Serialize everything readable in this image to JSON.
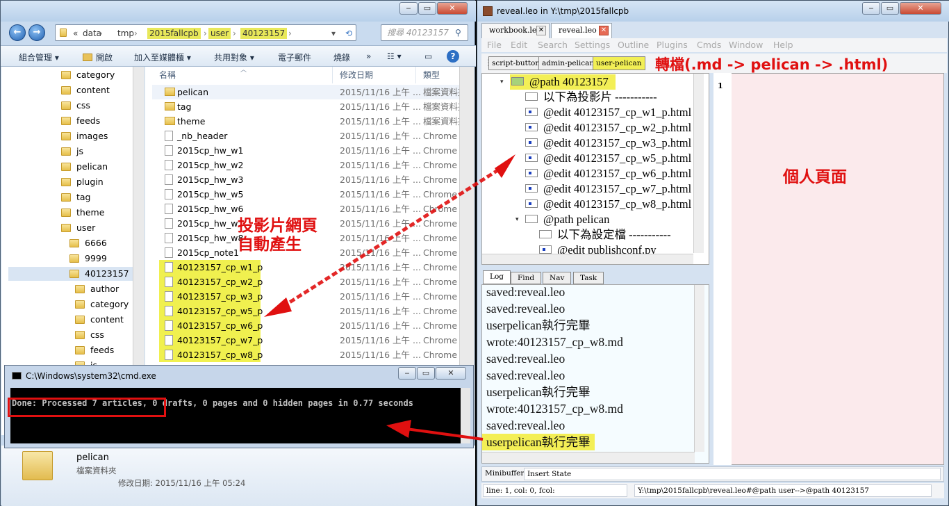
{
  "explorer": {
    "breadcrumbs": [
      "data",
      "tmp",
      "2015fallcpb",
      "user",
      "40123157"
    ],
    "breadcrumb_prefix": "«",
    "search_placeholder": "搜尋 40123157",
    "toolbar": [
      "組合管理 ▾",
      "開啟",
      "加入至媒體櫃 ▾",
      "共用對象 ▾",
      "電子郵件",
      "燒錄",
      "»"
    ],
    "nav_tree": [
      {
        "label": "category",
        "indent": 1
      },
      {
        "label": "content",
        "indent": 1
      },
      {
        "label": "css",
        "indent": 1
      },
      {
        "label": "feeds",
        "indent": 1
      },
      {
        "label": "images",
        "indent": 1
      },
      {
        "label": "js",
        "indent": 1
      },
      {
        "label": "pelican",
        "indent": 1
      },
      {
        "label": "plugin",
        "indent": 1
      },
      {
        "label": "tag",
        "indent": 1
      },
      {
        "label": "theme",
        "indent": 1
      },
      {
        "label": "user",
        "indent": 1
      },
      {
        "label": "6666",
        "indent": 2
      },
      {
        "label": "9999",
        "indent": 2
      },
      {
        "label": "40123157",
        "indent": 2,
        "selected": true
      },
      {
        "label": "author",
        "indent": 3
      },
      {
        "label": "category",
        "indent": 3
      },
      {
        "label": "content",
        "indent": 3
      },
      {
        "label": "css",
        "indent": 3
      },
      {
        "label": "feeds",
        "indent": 3
      },
      {
        "label": "js",
        "indent": 3
      }
    ],
    "columns": [
      "名稱",
      "修改日期",
      "類型"
    ],
    "files": [
      {
        "name": "pelican",
        "date": "2015/11/16 上午 ...",
        "type": "檔案資料夾",
        "folder": true
      },
      {
        "name": "tag",
        "date": "2015/11/16 上午 ...",
        "type": "檔案資料夾",
        "folder": true
      },
      {
        "name": "theme",
        "date": "2015/11/16 上午 ...",
        "type": "檔案資料夾",
        "folder": true
      },
      {
        "name": "_nb_header",
        "date": "2015/11/16 上午 ...",
        "type": "Chrome H"
      },
      {
        "name": "2015cp_hw_w1",
        "date": "2015/11/16 上午 ...",
        "type": "Chrome H"
      },
      {
        "name": "2015cp_hw_w2",
        "date": "2015/11/16 上午 ...",
        "type": "Chrome H"
      },
      {
        "name": "2015cp_hw_w3",
        "date": "2015/11/16 上午 ...",
        "type": "Chrome H"
      },
      {
        "name": "2015cp_hw_w5",
        "date": "2015/11/16 上午 ...",
        "type": "Chrome H"
      },
      {
        "name": "2015cp_hw_w6",
        "date": "2015/11/16 上午 ...",
        "type": "Chrome H"
      },
      {
        "name": "2015cp_hw_w7",
        "date": "2015/11/16 上午 ...",
        "type": "Chrome H"
      },
      {
        "name": "2015cp_hw_w8",
        "date": "2015/11/16 上午 ...",
        "type": "Chrome H"
      },
      {
        "name": "2015cp_note1",
        "date": "2015/11/16 上午 ...",
        "type": "Chrome H"
      },
      {
        "name": "40123157_cp_w1_p",
        "date": "2015/11/16 上午 ...",
        "type": "Chrome H",
        "highlight": true
      },
      {
        "name": "40123157_cp_w2_p",
        "date": "2015/11/16 上午 ...",
        "type": "Chrome H",
        "highlight": true
      },
      {
        "name": "40123157_cp_w3_p",
        "date": "2015/11/16 上午 ...",
        "type": "Chrome H",
        "highlight": true
      },
      {
        "name": "40123157_cp_w5_p",
        "date": "2015/11/16 上午 ...",
        "type": "Chrome H",
        "highlight": true
      },
      {
        "name": "40123157_cp_w6_p",
        "date": "2015/11/16 上午 ...",
        "type": "Chrome H",
        "highlight": true
      },
      {
        "name": "40123157_cp_w7_p",
        "date": "2015/11/16 上午 ...",
        "type": "Chrome H",
        "highlight": true
      },
      {
        "name": "40123157_cp_w8_p",
        "date": "2015/11/16 上午 ...",
        "type": "Chrome H",
        "highlight": true
      }
    ],
    "details": {
      "name": "pelican",
      "type": "檔案資料夾",
      "modified": "修改日期: 2015/11/16 上午 05:24"
    }
  },
  "cmd": {
    "title": "C:\\Windows\\system32\\cmd.exe",
    "output": "Done: Processed 7 articles, 0 drafts, 0 pages and 0 hidden pages in 0.77 seconds"
  },
  "leo": {
    "title": "reveal.leo in Y:\\tmp\\2015fallcpb",
    "tabs": [
      "workbook.leo",
      "reveal.leo"
    ],
    "menu": [
      "File",
      "Edit",
      "Search",
      "Settings",
      "Outline",
      "Plugins",
      "Cmds",
      "Window",
      "Help"
    ],
    "buttons": [
      "script-button",
      "admin-pelican",
      "user-pelican"
    ],
    "outline": [
      {
        "text": "@path 40123157",
        "indent": 0,
        "expand": "▾",
        "selected": true,
        "icon": "green"
      },
      {
        "text": "以下為投影片 -----------",
        "indent": 1,
        "icon": "plain"
      },
      {
        "text": "@edit 40123157_cp_w1_p.html",
        "indent": 1,
        "icon": "dot"
      },
      {
        "text": "@edit 40123157_cp_w2_p.html",
        "indent": 1,
        "icon": "dot"
      },
      {
        "text": "@edit 40123157_cp_w3_p.html",
        "indent": 1,
        "icon": "dot"
      },
      {
        "text": "@edit 40123157_cp_w5_p.html",
        "indent": 1,
        "icon": "dot"
      },
      {
        "text": "@edit 40123157_cp_w6_p.html",
        "indent": 1,
        "icon": "dot"
      },
      {
        "text": "@edit 40123157_cp_w7_p.html",
        "indent": 1,
        "icon": "dot"
      },
      {
        "text": "@edit 40123157_cp_w8_p.html",
        "indent": 1,
        "icon": "dot"
      },
      {
        "text": "@path pelican",
        "indent": 1,
        "expand": "▾",
        "icon": "plain"
      },
      {
        "text": "以下為設定檔 -----------",
        "indent": 2,
        "icon": "plain"
      },
      {
        "text": "@edit publishconf.py",
        "indent": 2,
        "icon": "dot"
      }
    ],
    "body_line_number": "1",
    "log_tabs": [
      "Log",
      "Find",
      "Nav",
      "Task"
    ],
    "log": [
      {
        "text": "saved:reveal.leo"
      },
      {
        "text": "saved:reveal.leo"
      },
      {
        "text": "userpelican執行完畢"
      },
      {
        "text": "wrote:40123157_cp_w8.md"
      },
      {
        "text": "saved:reveal.leo"
      },
      {
        "text": "saved:reveal.leo"
      },
      {
        "text": "userpelican執行完畢"
      },
      {
        "text": "wrote:40123157_cp_w8.md"
      },
      {
        "text": "saved:reveal.leo"
      },
      {
        "text": "userpelican執行完畢",
        "highlight": true
      }
    ],
    "minibuffer_label": "Minibuffer:",
    "minibuffer_value": "Insert State",
    "status_pos": "line: 1, col: 0, fcol:",
    "status_path": "Y:\\tmp\\2015fallcpb\\reveal.leo#@path user-->@path 40123157"
  },
  "annotations": {
    "convert": "轉檔(.md -> pelican -> .html)",
    "auto_generate_line1": "投影片網頁",
    "auto_generate_line2": "自動產生",
    "personal_page": "個人頁面"
  },
  "colors": {
    "annotation": "#e01010",
    "highlight": "#f0f04f"
  }
}
